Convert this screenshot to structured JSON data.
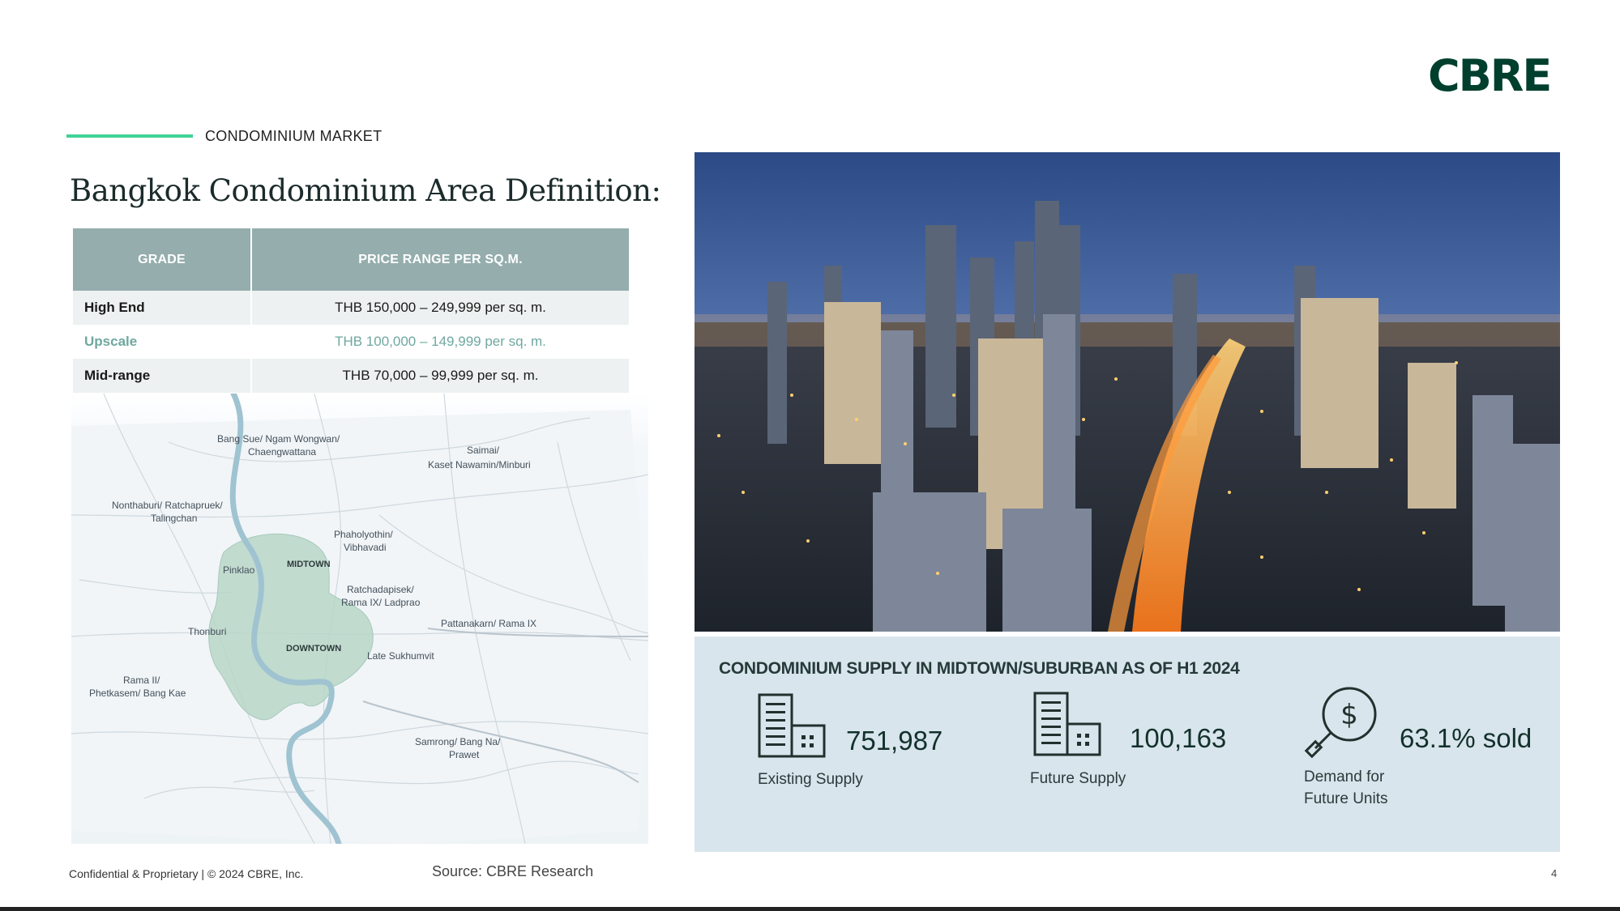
{
  "brand": {
    "logo_text": "CBRE",
    "accent_color": "#3fd396",
    "brand_color": "#003f2d"
  },
  "header": {
    "section_label": "CONDOMINIUM MARKET",
    "title": "Bangkok Condominium Area Definition:"
  },
  "grade_table": {
    "columns": [
      "GRADE",
      "PRICE RANGE PER SQ.M."
    ],
    "rows": [
      {
        "grade": "High End",
        "price": "THB 150,000 – 249,999 per sq. m."
      },
      {
        "grade": "Upscale",
        "price": "THB 100,000 – 149,999 per sq. m."
      },
      {
        "grade": "Mid-range",
        "price": "THB 70,000 – 99,999 per sq. m."
      }
    ]
  },
  "map": {
    "labels": {
      "bang_sue": "Bang Sue/ Ngam Wongwan/",
      "bang_sue_2": "Chaengwattana",
      "saimai": "Saimai/",
      "saimai_2": "Kaset Nawamin/Minburi",
      "nonthaburi": "Nonthaburi/ Ratchapruek/",
      "nonthaburi_2": "Talingchan",
      "phaholyothin": "Phaholyothin/",
      "phaholyothin_2": "Vibhavadi",
      "midtown": "MIDTOWN",
      "pinklao": "Pinklao",
      "ratchada": "Ratchadapisek/",
      "ratchada_2": "Rama IX/ Ladprao",
      "thonburi": "Thonburi",
      "pattanakarn": "Pattanakarn/ Rama IX",
      "downtown": "DOWNTOWN",
      "sukhumvit": "Late Sukhumvit",
      "rama2": "Rama II/",
      "rama2_2": "Phetkasem/ Bang Kae",
      "samrong": "Samrong/ Bang Na/",
      "samrong_2": "Prawet"
    }
  },
  "supply": {
    "title": "CONDOMINIUM SUPPLY IN MIDTOWN/SUBURBAN AS OF H1 2024",
    "stats": [
      {
        "value": "751,987",
        "label": "Existing Supply",
        "icon": "building-icon"
      },
      {
        "value": "100,163",
        "label": "Future Supply",
        "icon": "building-icon"
      },
      {
        "value": "63.1% sold",
        "label_line1": "Demand for",
        "label_line2": "Future Units",
        "icon": "dollar-magnifier-icon"
      }
    ]
  },
  "footer": {
    "confidential": "Confidential & Proprietary | © 2024 CBRE, Inc.",
    "source": "Source: CBRE Research",
    "page_number": "4"
  }
}
